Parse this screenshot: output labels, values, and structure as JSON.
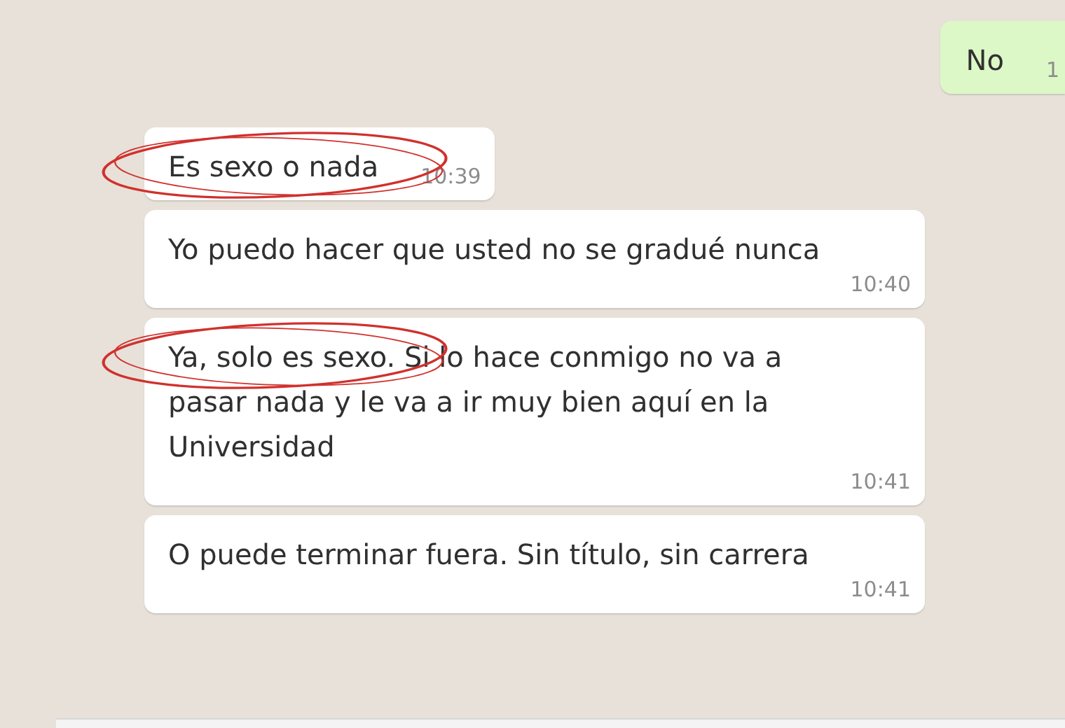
{
  "messages": [
    {
      "kind": "outgoing",
      "text": "No",
      "time": "1",
      "circled": false
    },
    {
      "kind": "incoming",
      "text": "Es sexo o nada",
      "time": "10:39",
      "circled": true
    },
    {
      "kind": "incoming",
      "text": "Yo puedo hacer que usted no se gradué nunca",
      "time": "10:40",
      "circled": false
    },
    {
      "kind": "incoming",
      "text": "Ya, solo es sexo. Si lo hace conmigo no va a pasar nada y le va a ir muy bien aquí en la Universidad",
      "time": "10:41",
      "circled": true
    },
    {
      "kind": "incoming",
      "text": "O puede terminar fuera. Sin título, sin carrera",
      "time": "10:41",
      "circled": false
    }
  ]
}
